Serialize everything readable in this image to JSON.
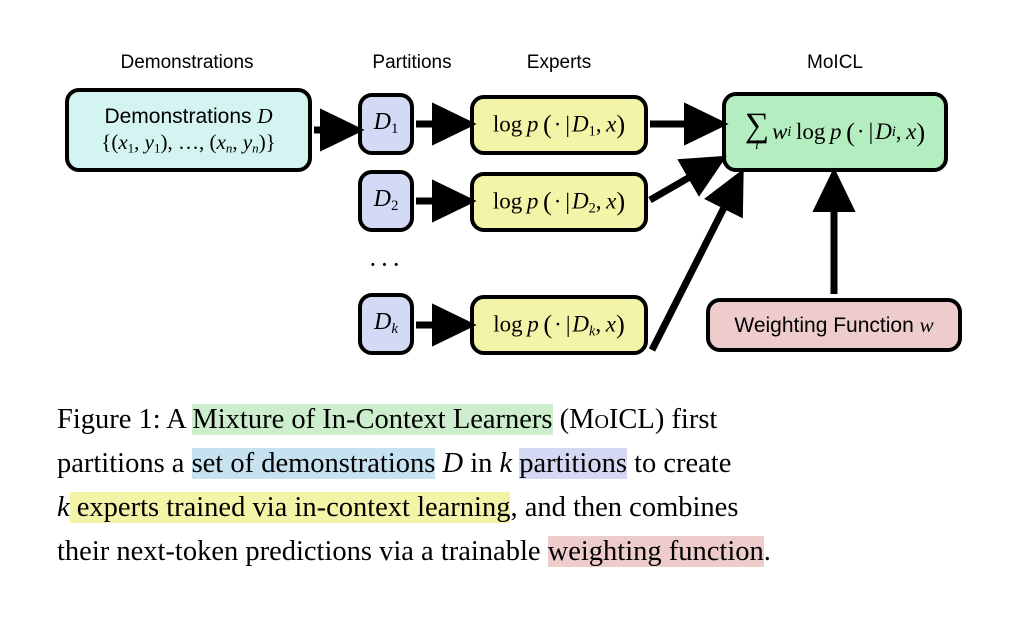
{
  "figure": {
    "column_labels": [
      {
        "id": "demonstrations",
        "text": "Demonstrations"
      },
      {
        "id": "partitions",
        "text": "Partitions"
      },
      {
        "id": "experts",
        "text": "Experts"
      },
      {
        "id": "moicl",
        "text": "MoICL"
      }
    ],
    "demonstrations_box": {
      "line1_prefix": "Demonstrations ",
      "line1_symbol": "D",
      "line2": "{(x₁, y₁), …, (xₙ, yₙ)}",
      "color": "#d4f4f1"
    },
    "partitions": [
      {
        "id": "d1",
        "symbol": "D",
        "subscript": "1",
        "color": "#d3daf5"
      },
      {
        "id": "d2",
        "symbol": "D",
        "subscript": "2",
        "color": "#d3daf5"
      },
      {
        "id": "dk",
        "symbol": "D",
        "subscript": "k",
        "color": "#d3daf5"
      }
    ],
    "ellipsis": "···",
    "experts": [
      {
        "id": "expert1",
        "text": "log p ( · | D₁, x)",
        "subscript": "1",
        "color": "#f4f4a8"
      },
      {
        "id": "expert2",
        "text": "log p ( · | D₂, x)",
        "subscript": "2",
        "color": "#f4f4a8"
      },
      {
        "id": "expertk",
        "text": "log p ( · | Dₖ, x)",
        "subscript": "k",
        "color": "#f4f4a8"
      }
    ],
    "moicl_box": {
      "sum_symbol": "∑",
      "sum_index": "i",
      "expression": "wᵢ log p ( · | Dᵢ, x)",
      "color": "#b4edbf"
    },
    "weighting_box": {
      "label": "Weighting Function ",
      "symbol": "w",
      "color": "#eecccb"
    }
  },
  "caption": {
    "label": "Figure 1:",
    "full_text": "Figure 1: A Mixture of In-Context Learners (MoICL) first partitions a set of demonstrations D in k partitions to create k experts trained via in-context learning, and then combines their next-token predictions via a trainable weighting function.",
    "segments": {
      "s1": "A ",
      "s2": "Mixture of In-Context Learners",
      "s3": " (",
      "s4": "MoICL",
      "s5": ") first",
      "s6": "partitions a ",
      "s7": "set of demonstrations",
      "s8": " D ",
      "s9": "in ",
      "s10": "k",
      "s11": " ",
      "s12": "partitions",
      "s13": " to create",
      "s14": "k",
      "s15": " experts trained",
      "s16": " via in-context learning",
      "s17": ", and then combines",
      "s18": "their next-token predictions via a trainable ",
      "s19": "weighting function",
      "s20": "."
    },
    "highlight_colors": {
      "moicl_green": "#cceecd",
      "demonstrations_blue": "#c6e2f0",
      "partitions_lavender": "#d4d8f2",
      "experts_yellow": "#f4f4a8",
      "weighting_pink": "#eecccb"
    }
  }
}
